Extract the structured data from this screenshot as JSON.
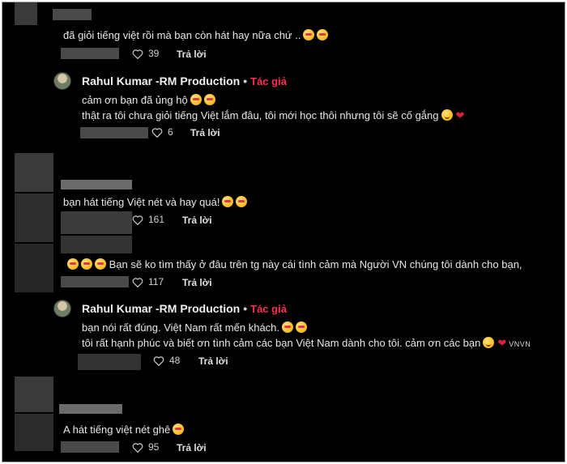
{
  "comments": [
    {
      "text": "đã giỏi tiếng việt rồi mà bạn còn hát hay nữa chứ ..",
      "likes": "39",
      "reply": "Trả lời"
    },
    {
      "name": "Rahul Kumar -RM Production",
      "author_tag": "Tác giả",
      "line1": "cảm ơn bạn đã ủng hộ",
      "line2": "thật ra tôi chưa giỏi tiếng Việt lắm đâu, tôi mới học thôi nhưng tôi sẽ cố gắng",
      "likes": "6",
      "reply": "Trả lời"
    },
    {
      "text": "bạn hát tiếng Việt nét và hay quá!",
      "likes": "161",
      "reply": "Trả lời"
    },
    {
      "text": "Bạn sẽ ko tìm thấy ở đâu trên tg này cái tình cảm mà Người VN chúng tôi dành cho bạn,",
      "likes": "117",
      "reply": "Trả lời"
    },
    {
      "name": "Rahul Kumar -RM Production",
      "author_tag": "Tác giả",
      "line1": "bạn nói rất đúng. Việt Nam rất mến khách.",
      "line2": "tôi rất hạnh phúc và biết ơn tình cảm các bạn Việt Nam dành cho tôi. cảm ơn các bạn",
      "suffix": "VNVN",
      "likes": "48",
      "reply": "Trả lời"
    },
    {
      "text": "A hát tiếng việt nét ghê",
      "likes": "95",
      "reply": "Trả lời"
    }
  ],
  "icons": {
    "like": "heart-outline-icon",
    "emoji_love": "smiling-face-with-heart-eyes-icon",
    "emoji_smile": "smiling-face-icon",
    "red_heart": "red-heart-icon"
  }
}
